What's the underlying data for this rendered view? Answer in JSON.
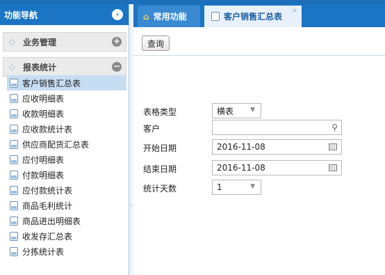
{
  "sidebar": {
    "title": "功能导航",
    "toggle_icon": "collapse-left-icon",
    "panels": [
      {
        "label": "业务管理",
        "state_icon": "expand-plus-icon"
      },
      {
        "label": "报表统计",
        "state_icon": "collapse-minus-icon"
      }
    ],
    "items": [
      {
        "label": "客户销售汇总表"
      },
      {
        "label": "应收明细表"
      },
      {
        "label": "收款明细表"
      },
      {
        "label": "应收款统计表"
      },
      {
        "label": "供应商配货汇总表"
      },
      {
        "label": "应付明细表"
      },
      {
        "label": "付款明细表"
      },
      {
        "label": "应付款统计表"
      },
      {
        "label": "商品毛利统计"
      },
      {
        "label": "商品进出明细表"
      },
      {
        "label": "收发存汇总表"
      },
      {
        "label": "分拣统计表"
      }
    ],
    "selected_index": 0
  },
  "tabs": [
    {
      "label": "常用功能",
      "icon": "home-icon"
    },
    {
      "label": "客户销售汇总表",
      "icon": "document-icon",
      "active": true
    }
  ],
  "toolbar": {
    "query_label": "查询"
  },
  "form": {
    "table_type_label": "表格类型",
    "table_type_value": "横表",
    "customer_label": "客户",
    "customer_value": "",
    "start_date_label": "开始日期",
    "start_date_value": "2016-11-08",
    "end_date_label": "结束日期",
    "end_date_value": "2016-11-08",
    "days_label": "统计天数",
    "days_value": "1"
  },
  "colors": {
    "accent": "#1b74c4",
    "selected": "#c7ddf3"
  }
}
